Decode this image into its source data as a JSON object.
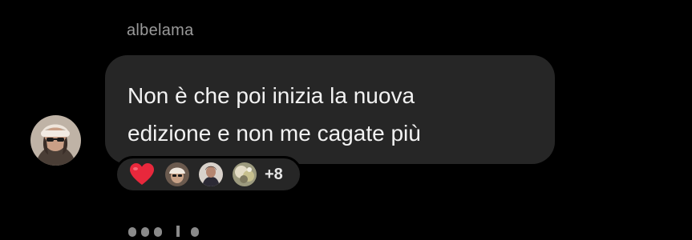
{
  "message": {
    "sender": "albelama",
    "text": "Non è che poi inizia la nuova\nedizione e non me cagate più"
  },
  "reactions": {
    "items": [
      "heart-emoji",
      "reactor-avatar-1",
      "reactor-avatar-2",
      "reactor-avatar-3"
    ],
    "extra_count": "+8"
  },
  "colors": {
    "background": "#000000",
    "bubble": "#262626",
    "message_text": "#f2f2f2",
    "sender_text": "#9a9a9a",
    "heart": "#e8283c"
  }
}
